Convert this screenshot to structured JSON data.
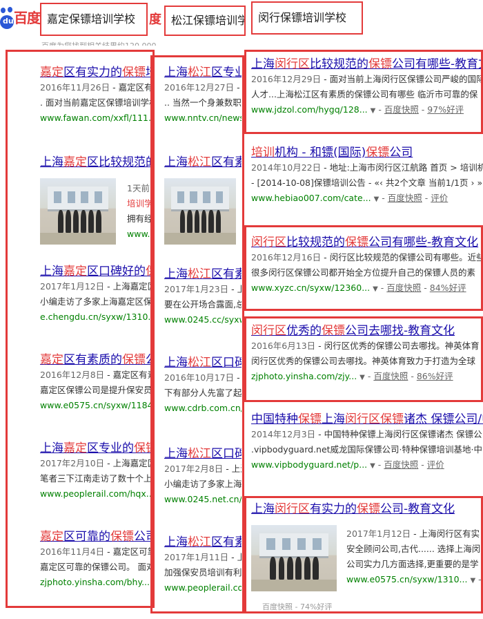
{
  "search": {
    "logo_text": "百度",
    "logo_du": "du",
    "queries": [
      "嘉定保镖培训学校",
      "松江保镖培训学校",
      "闵行保镖培训学校"
    ],
    "stray_char": "度",
    "gray_info": "百度为您找到相关结果约120,000"
  },
  "panel1": {
    "results": [
      {
        "title_pre": "",
        "title_hl": "嘉定",
        "title_post": "区有实力的",
        "title_hl2": "保镖",
        "title_post2": "培训",
        "date": "2016年11月26日",
        "snippet_a": " - 嘉定区有实",
        "snippet_b": ". 面对当前嘉定区保镖培训学校",
        "url": "www.fawan.com/xxfl/111..."
      },
      {
        "title_pre": "上海",
        "title_hl": "嘉定",
        "title_post": "区比较规范的",
        "title_hl2": "保",
        "title_post2": "",
        "date": "1天前",
        "snippet_a": "培训学",
        "snippet_b": "拥有经",
        "url": "www.e"
      },
      {
        "title_pre": "上海",
        "title_hl": "嘉定",
        "title_post": "区口碑好的",
        "title_hl2": "保镖",
        "title_post2": "",
        "date": "2017年1月12日",
        "snippet_a": " - 上海嘉定区口",
        "snippet_b": "小编走访了多家上海嘉定区保镖",
        "url": "e.chengdu.cn/syxw/1310..."
      },
      {
        "title_pre": "",
        "title_hl": "嘉定",
        "title_post": "区有素质的",
        "title_hl2": "保镖",
        "title_post2": "公司",
        "date": "2016年12月8日",
        "snippet_a": " - 嘉定区有素质",
        "snippet_b": "嘉定区保镖公司是提升保安员前",
        "url": "www.e0575.cn/syxw/1184..."
      },
      {
        "title_pre": "上海",
        "title_hl": "嘉定",
        "title_post": "区专业的",
        "title_hl2": "保镖",
        "title_post2": "培",
        "date": "2017年2月10日",
        "snippet_a": " - 上海嘉定区专",
        "snippet_b": "笔者三下江南走访了数十个上海",
        "url": "www.peoplerail.com/hqx..."
      },
      {
        "title_pre": "",
        "title_hl": "嘉定",
        "title_post": "区可靠的",
        "title_hl2": "保镖",
        "title_post2": "公司-教",
        "date": "2016年11月4日",
        "snippet_a": " - 嘉定区可靠的",
        "snippet_b": "嘉定区可靠的保镖公司。 面对当",
        "url": "zjphoto.yinsha.com/bhy..."
      }
    ]
  },
  "panel2": {
    "results": [
      {
        "title_pre": "上海",
        "title_hl": "松江",
        "title_post": "区专业的",
        "title_hl2": "保",
        "title_post2": "",
        "date": "2016年12月27日",
        "snippet_a": " - 上海",
        "snippet_b": ".. 当然一个身兼数职的",
        "url": "www.nntv.cn/news/hyzx"
      },
      {
        "title_pre": "上海",
        "title_hl": "松江",
        "title_post": "区有素质",
        "title_hl2": "",
        "title_post2": "",
        "date": "",
        "snippet_a": "",
        "snippet_b": "",
        "url": ""
      },
      {
        "title_pre": "上海",
        "title_hl": "松江",
        "title_post": "区有素质",
        "title_hl2": "",
        "title_post2": "",
        "date": "2017年1月23日",
        "snippet_a": " - 上海",
        "snippet_b": "要在公开场合露面,总会",
        "url": "www.0245.cc/syxw/1321"
      },
      {
        "title_pre": "上海",
        "title_hl": "松江",
        "title_post": "区口碑好",
        "title_hl2": "",
        "title_post2": "",
        "date": "2016年10月17日",
        "snippet_a": " - 上海",
        "snippet_b": "下有部分人先富了起来",
        "url": "www.cdrb.com.cn/hyxw/"
      },
      {
        "title_pre": "上海",
        "title_hl": "松江",
        "title_post": "区口碑好",
        "title_hl2": "",
        "title_post2": "",
        "date": "2017年2月8日",
        "snippet_a": " - 上海",
        "snippet_b": "小编走访了多家上海松",
        "url": "www.0245.net.cn/syxw/"
      },
      {
        "title_pre": "上海",
        "title_hl": "松江",
        "title_post": "区有素质",
        "title_hl2": "",
        "title_post2": "",
        "date": "2017年1月11日",
        "snippet_a": " - 上海",
        "snippet_b": "加强保安员培训有利于(",
        "url": "www.peoplerail.com/hqx..."
      }
    ],
    "bottom_extra": "百度快照 - 74%好评"
  },
  "panel3": {
    "results": [
      {
        "title_pre": "上海",
        "title_hl": "闵行区",
        "title_post": "比较规范的",
        "title_hl2": "保镖",
        "title_post2": "公司有哪些-教育文化",
        "date": "2016年12月29日",
        "snippet_a": " - 面对当前上海闵行区保镖公司严峻的国际",
        "snippet_b": "人才...上海松江区有素质的保镖公司有哪些 临沂市可靠的保",
        "url": "www.jdzol.com/hygq/128...",
        "snap": "百度快照",
        "rating": "97%好评"
      },
      {
        "title_pre": "",
        "title_hl": "培训",
        "title_post": "机构 - 和镖(国际)",
        "title_hl2": "保镖",
        "title_post2": "公司",
        "date": "2014年10月22日",
        "snippet_a": " - 地址:上海市闵行区江航路 首页 > 培训机",
        "snippet_b": "- [2014-10-08]保镖培训公告 - «‹ 共2个文章 当前1/1页 › »",
        "url": "www.hebiao007.com/cate...",
        "snap": "百度快照",
        "rating": "评价"
      },
      {
        "title_pre": "",
        "title_hl": "闵行区",
        "title_post": "比较规范的",
        "title_hl2": "保镖",
        "title_post2": "公司有哪些-教育文化",
        "date": "2016年12月16日",
        "snippet_a": " - 闵行区比较规范的保镖公司有哪些。近些",
        "snippet_b": "很多闵行区保镖公司都开始全方位提升自己的保镖人员的素",
        "url": "www.xyzc.cn/syxw/12360...",
        "snap": "百度快照",
        "rating": "84%好评"
      },
      {
        "title_pre": "",
        "title_hl": "闵行区",
        "title_post": "优秀的",
        "title_hl2": "保镖",
        "title_post2": "公司去哪找-教育文化",
        "date": "2016年6月13日",
        "snippet_a": " - 闵行区优秀的保镖公司去哪找。神英体育",
        "snippet_b": "闵行区优秀的保镖公司去哪找。神英体育致力于打造为全球",
        "url": "zjphoto.yinsha.com/zjy...",
        "snap": "百度快照",
        "rating": "86%好评"
      },
      {
        "title_pre": "中国特种",
        "title_hl": "保镖",
        "title_post": "上海",
        "title_hl2": "闵行区保镖",
        "title_post2": "诸杰 保镖公司/中国",
        "date": "2014年12月3日",
        "snippet_a": " - 中国特种保镖上海闵行区保镖诸杰 保镖公",
        "snippet_b": ".vipbodyguard.net威龙国际保镖公司·特种保镖培训基地·中",
        "url": "www.vipbodyguard.net/p...",
        "snap": "百度快照",
        "rating": "评价"
      },
      {
        "title_pre": "上海",
        "title_hl": "闵行区",
        "title_post": "有实力的",
        "title_hl2": "保镖",
        "title_post2": "公司-教育文化",
        "date": "2017年1月12日",
        "snippet_a": " - 上海闵行区有实",
        "snippet_b": "安全顾问公司,古代...... 选择上海闵",
        "snippet_c": "公司实力几方面选择,更重要的是学",
        "url": "www.e0575.cn/syxw/1310...",
        "snap": "百",
        "rating": ""
      }
    ]
  }
}
